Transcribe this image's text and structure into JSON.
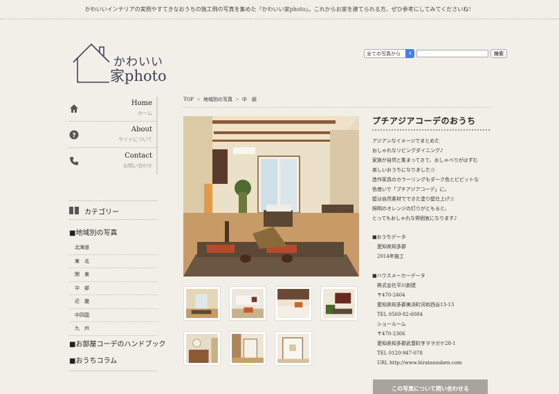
{
  "topbar": {
    "tagline": "かわいいインテリアの実例やすてきなおうちの施工例の写真を集めた『かわいい家photo』。これからお家を建てられる方、ぜひ参考にしてみてくださいね！"
  },
  "logo": {
    "line1": "かわいい",
    "line2": "家photo"
  },
  "search": {
    "select_value": "全ての写真から",
    "input_value": "",
    "button_label": "検索"
  },
  "nav": [
    {
      "en": "Home",
      "jp": "ホーム",
      "icon": "home-icon"
    },
    {
      "en": "About",
      "jp": "サイトについて",
      "icon": "question-icon"
    },
    {
      "en": "Contact",
      "jp": "お問い合わせ",
      "icon": "phone-icon"
    }
  ],
  "sidebar": {
    "category_label": "カテゴリー",
    "regions_title": "■地域別の写真",
    "regions": [
      "北海道",
      "東　北",
      "関　東",
      "中　部",
      "近　畿",
      "中四国",
      "九　州"
    ],
    "handbook": "■お部屋コーデのハンドブック",
    "column": "■おうちコラム"
  },
  "breadcrumb": {
    "top": "TOP",
    "sep": ">",
    "region_list": "地域別の写真",
    "current": "中　部"
  },
  "article": {
    "title": "プチアジアコーデのおうち",
    "description": [
      "アジアンなイメージでまとめた",
      "おしゃれなリビングダイニング♪",
      "家族が自然と集まってきて、おしゃべりがはずむ",
      "楽しいおうちになりました☆",
      "造作家具のカラーリングもダーク色とビビットな",
      "色使いで「プチアジアコーデ」に。",
      "壁は自然素材でできた塗り壁仕上げ☆",
      "照明のオレンジの灯りがともると、",
      "とってもおしゃれな雰囲気になります♪"
    ],
    "house_data_title": "■おうちデータ",
    "house_data": [
      "愛知県知多郡",
      "2014年施工"
    ],
    "maker_title": "■ハウスメーカーデータ",
    "maker_data": [
      "株式会社平川創建",
      "〒470-2404",
      "愛知県知多郡美浜町河和西谷13-13",
      "TEL 0569-82-6084",
      "ショールーム",
      "〒470-2366",
      "愛知県知多郡武豊町字ヲヲガケ28-1",
      "TEL 0120-947-078",
      "URL http://www.hiratasouken.com"
    ],
    "contact_button": "この写真について問い合わせる"
  }
}
